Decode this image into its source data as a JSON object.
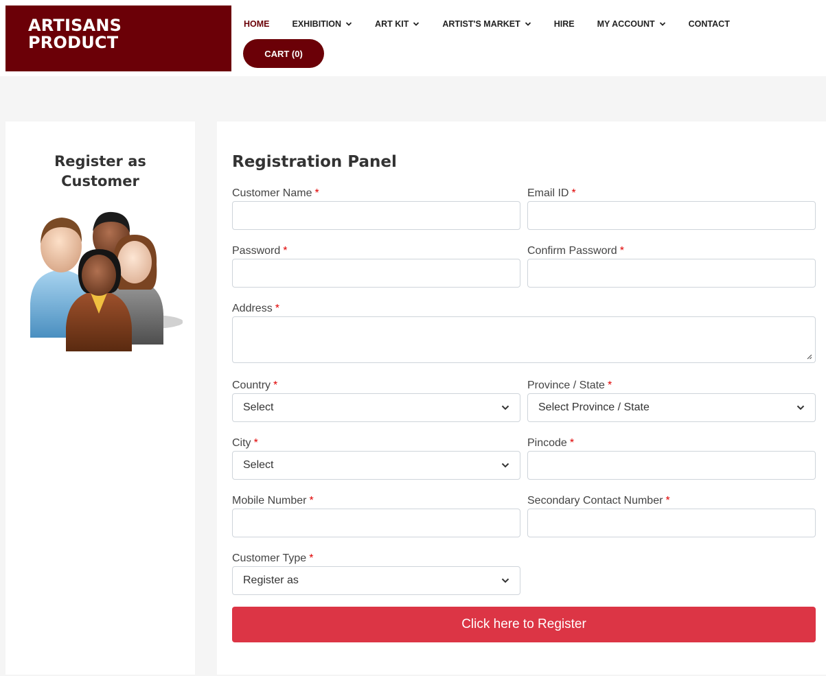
{
  "brand": {
    "line1": "ARTISANS",
    "line2": "PRODUCT",
    "color": "#6b0007"
  },
  "nav": [
    {
      "label": "HOME",
      "dropdown": false,
      "active": true
    },
    {
      "label": "EXHIBITION",
      "dropdown": true
    },
    {
      "label": "ART KIT",
      "dropdown": true
    },
    {
      "label": "ARTIST'S MARKET",
      "dropdown": true
    },
    {
      "label": "HIRE",
      "dropdown": false
    },
    {
      "label": "MY ACCOUNT",
      "dropdown": true
    },
    {
      "label": "CONTACT",
      "dropdown": false
    }
  ],
  "cart": {
    "label": "CART (0)"
  },
  "sidebar": {
    "title_line1": "Register as",
    "title_line2": "Customer",
    "image_icon": "people-group-icon"
  },
  "form": {
    "title": "Registration Panel",
    "required_mark": "*",
    "fields": {
      "customer_name": {
        "label": "Customer Name",
        "value": ""
      },
      "email": {
        "label": "Email ID",
        "value": ""
      },
      "password": {
        "label": "Password",
        "value": ""
      },
      "confirm_password": {
        "label": "Confirm Password",
        "value": ""
      },
      "address": {
        "label": "Address",
        "value": ""
      },
      "country": {
        "label": "Country",
        "selected": "Select"
      },
      "province": {
        "label": "Province / State",
        "selected": "Select Province / State"
      },
      "city": {
        "label": "City",
        "selected": "Select"
      },
      "pincode": {
        "label": "Pincode",
        "value": ""
      },
      "mobile": {
        "label": "Mobile Number",
        "value": ""
      },
      "secondary_contact": {
        "label": "Secondary Contact Number",
        "value": ""
      },
      "customer_type": {
        "label": "Customer Type",
        "selected": "Register as"
      }
    },
    "submit_label": "Click here to Register",
    "submit_color": "#dc3545"
  }
}
